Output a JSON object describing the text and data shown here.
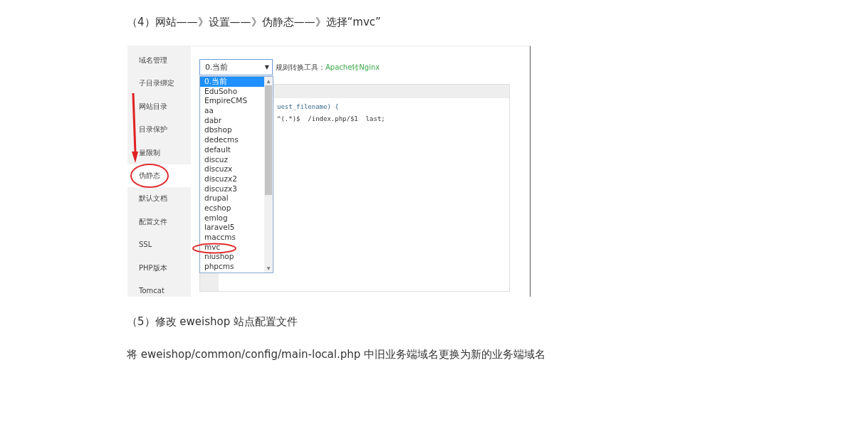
{
  "step_4": {
    "heading": "（4）网站——》设置——》伪静态——》选择“mvc”"
  },
  "screenshot": {
    "sidebar": {
      "items": [
        {
          "label": "域名管理",
          "selected": false
        },
        {
          "label": "子目录绑定",
          "selected": false
        },
        {
          "label": "网站目录",
          "selected": false
        },
        {
          "label": "目录保护",
          "selected": false
        },
        {
          "label": "量限制",
          "selected": false
        },
        {
          "label": "伪静态",
          "selected": true
        },
        {
          "label": "默认文档",
          "selected": false
        },
        {
          "label": "配置文件",
          "selected": false
        },
        {
          "label": "SSL",
          "selected": false
        },
        {
          "label": "PHP版本",
          "selected": false
        },
        {
          "label": "Tomcat",
          "selected": false
        }
      ]
    },
    "rule_select": {
      "value": "0.当前",
      "arrow": "▼"
    },
    "tool_label": "规则转换工具：",
    "tool_link": "Apache转Nginx",
    "dropdown": {
      "options": [
        {
          "label": "0.当前",
          "selected": true
        },
        {
          "label": "EduSoho",
          "selected": false
        },
        {
          "label": "EmpireCMS",
          "selected": false
        },
        {
          "label": "aa",
          "selected": false
        },
        {
          "label": "dabr",
          "selected": false
        },
        {
          "label": "dbshop",
          "selected": false
        },
        {
          "label": "dedecms",
          "selected": false
        },
        {
          "label": "default",
          "selected": false
        },
        {
          "label": "discuz",
          "selected": false
        },
        {
          "label": "discuzx",
          "selected": false
        },
        {
          "label": "discuzx2",
          "selected": false
        },
        {
          "label": "discuzx3",
          "selected": false
        },
        {
          "label": "drupal",
          "selected": false
        },
        {
          "label": "ecshop",
          "selected": false
        },
        {
          "label": "emlog",
          "selected": false
        },
        {
          "label": "laravel5",
          "selected": false
        },
        {
          "label": "maccms",
          "selected": false
        },
        {
          "label": "mvc",
          "selected": false
        },
        {
          "label": "niushop",
          "selected": false
        },
        {
          "label": "phpcms",
          "selected": false
        }
      ],
      "scroll_up": "▲",
      "scroll_down": "▼"
    },
    "code_lines": [
      "uest_filename) {",
      "^(.*)$  /index.php/$1  last;"
    ]
  },
  "step_5": {
    "heading": "（5）修改 eweishop 站点配置文件"
  },
  "instruction": "将 eweishop/common/config/main-local.php 中旧业务端域名更换为新的业务端域名"
}
